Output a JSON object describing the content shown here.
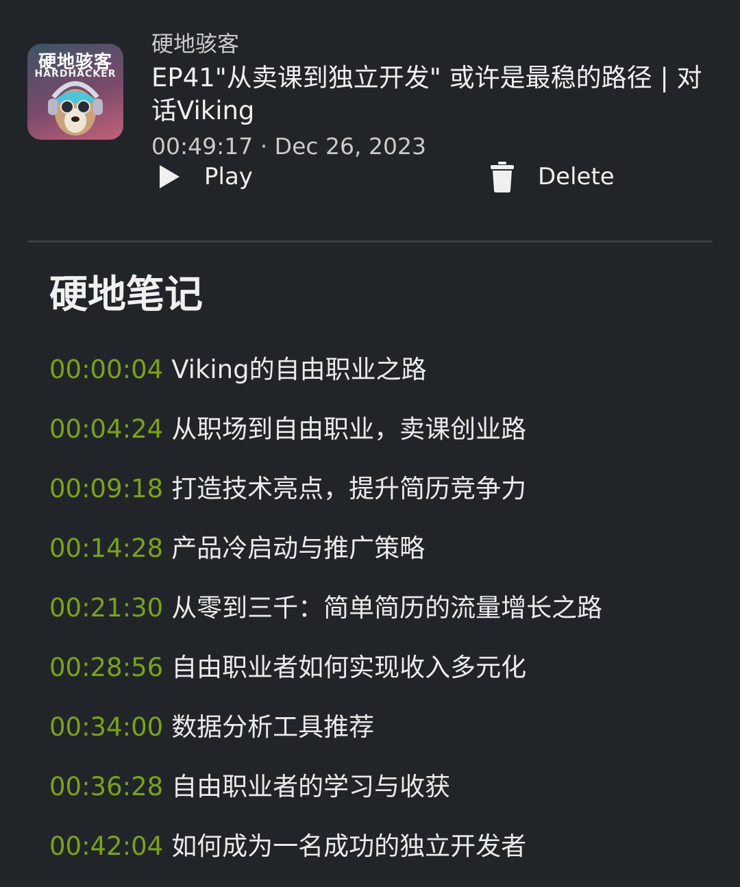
{
  "episode": {
    "podcast_name": "硬地骇客",
    "title": "EP41\"从卖课到独立开发\" 或许是最稳的路径 | 对话Viking",
    "info": "00:49:17 · Dec 26, 2023",
    "cover": {
      "title": "硬地骇客",
      "subtitle": "HARDHACKER"
    }
  },
  "actions": {
    "play_label": "Play",
    "delete_label": "Delete"
  },
  "notes": {
    "title": "硬地笔记",
    "chapters": [
      {
        "time": "00:00:04",
        "text": "Viking的自由职业之路"
      },
      {
        "time": "00:04:24",
        "text": "从职场到自由职业，卖课创业路"
      },
      {
        "time": "00:09:18",
        "text": "打造技术亮点，提升简历竞争力"
      },
      {
        "time": "00:14:28",
        "text": "产品冷启动与推广策略"
      },
      {
        "time": "00:21:30",
        "text": "从零到三千：简单简历的流量增长之路"
      },
      {
        "time": "00:28:56",
        "text": "自由职业者如何实现收入多元化"
      },
      {
        "time": "00:34:00",
        "text": "数据分析工具推荐"
      },
      {
        "time": "00:36:28",
        "text": "自由职业者的学习与收获"
      },
      {
        "time": "00:42:04",
        "text": "如何成为一名成功的独立开发者"
      }
    ]
  },
  "colors": {
    "background": "#212529",
    "timestamp": "#7aa319",
    "text": "#ebebeb",
    "muted": "#c9cbcd"
  },
  "icons": {
    "play": "play-icon",
    "delete": "trash-icon"
  }
}
